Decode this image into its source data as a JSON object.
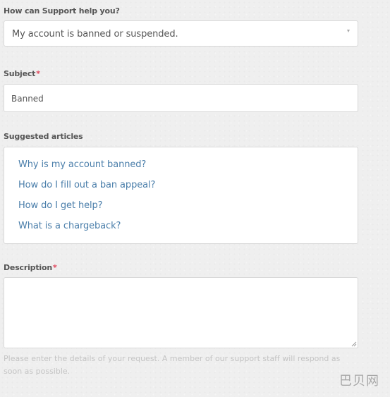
{
  "form": {
    "topic": {
      "label": "How can Support help you?",
      "selected": "My account is banned or suspended."
    },
    "subject": {
      "label": "Subject",
      "required_mark": "*",
      "value": "Banned"
    },
    "suggested": {
      "label": "Suggested articles",
      "items": [
        "Why is my account banned?",
        "How do I fill out a ban appeal?",
        "How do I get help?",
        "What is a chargeback?"
      ]
    },
    "description": {
      "label": "Description",
      "required_mark": "*",
      "value": "",
      "help": "Please enter the details of your request. A member of our support staff will respond as soon as possible."
    }
  },
  "watermark": "巴贝网",
  "colors": {
    "link": "#4a7eaa",
    "required": "#e0455a",
    "background": "#efefef"
  }
}
